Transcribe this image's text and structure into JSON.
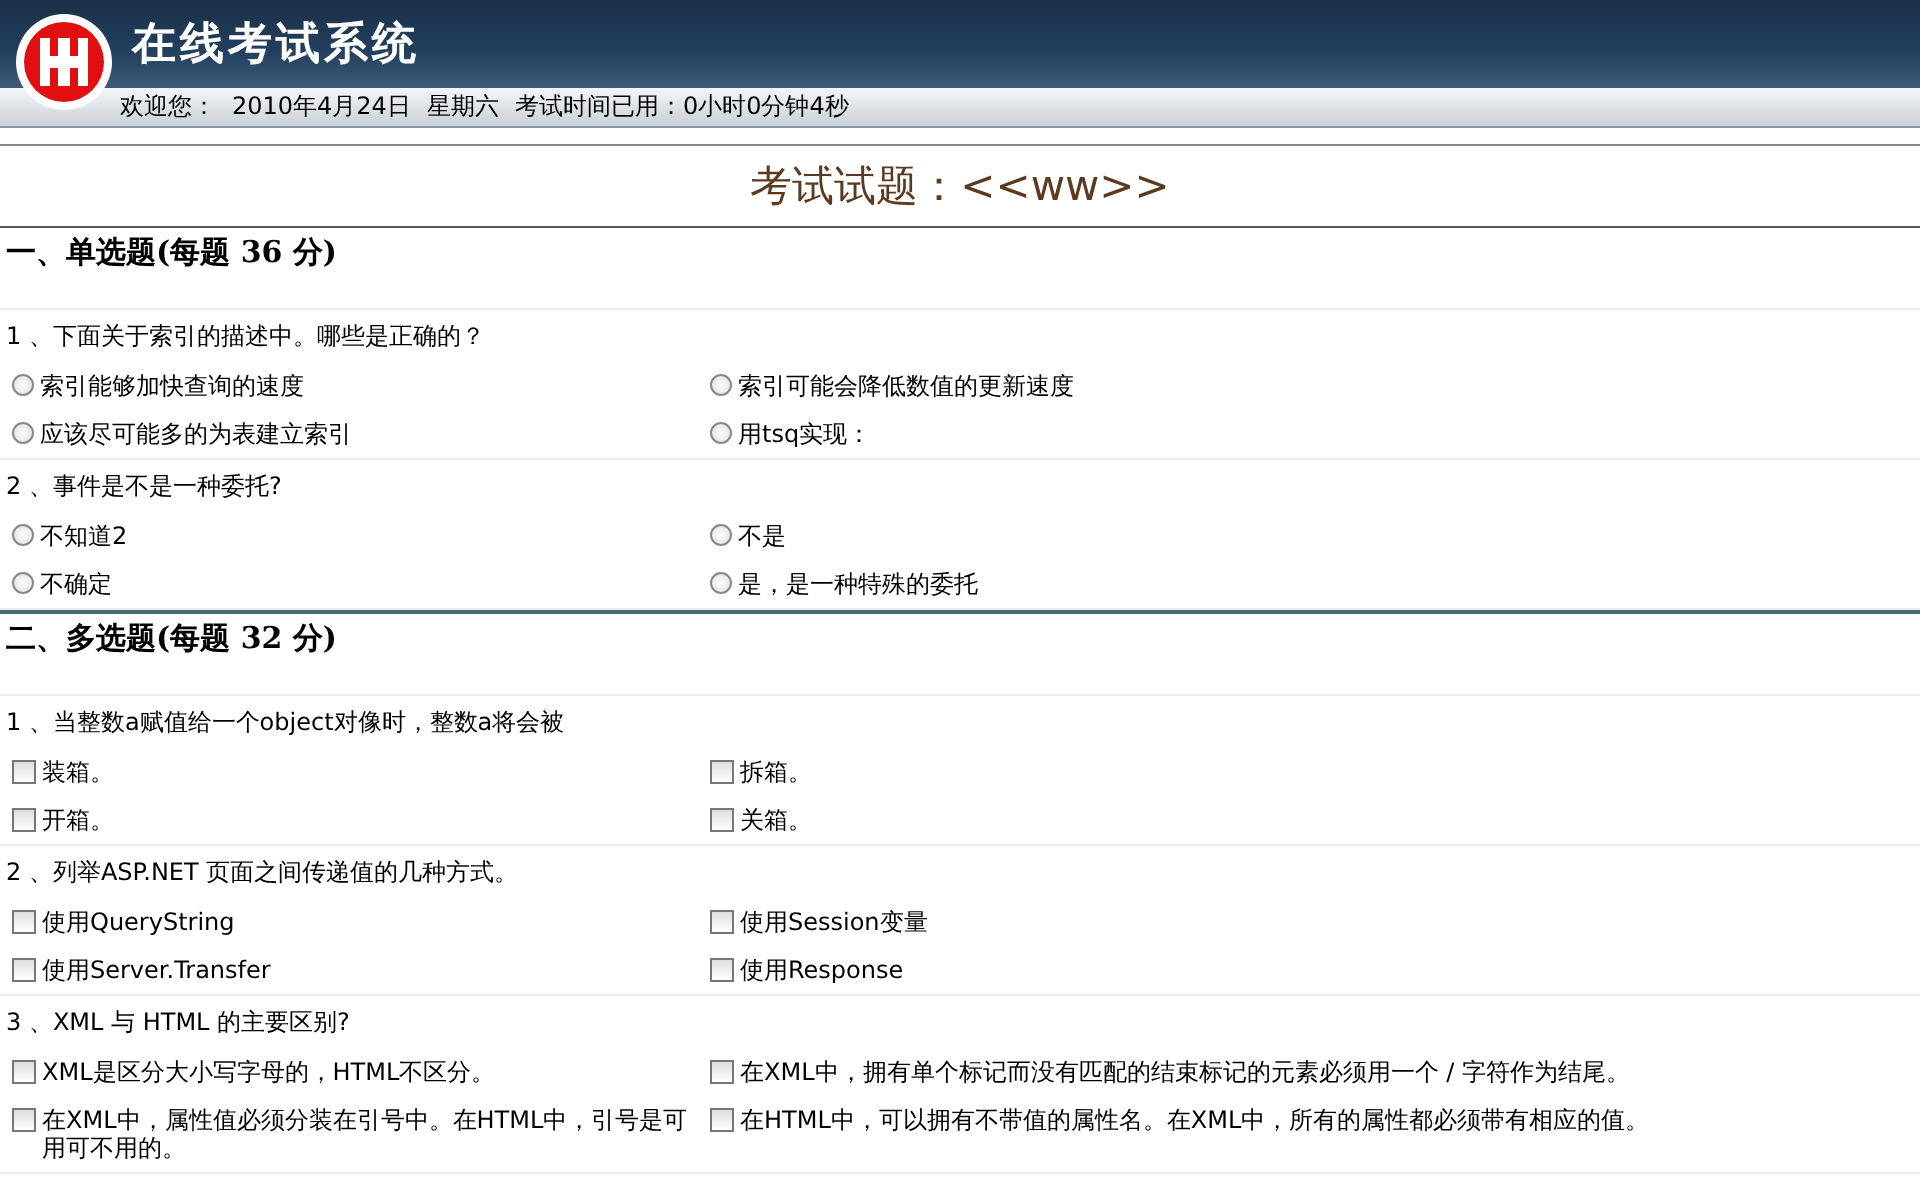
{
  "header": {
    "title": "在线考试系统",
    "status": [
      "欢迎您：",
      "2010年4月24日",
      "星期六",
      "考试时间已用：0小时0分钟4秒"
    ]
  },
  "exam_title": "考试试题：<<ww>>",
  "sections": [
    {
      "heading": "一、单选题(每题  36 分)",
      "kind": "radio",
      "questions": [
        {
          "prompt": "1 、下面关于索引的描述中。哪些是正确的？",
          "options": [
            {
              "label": "索引能够加快查询的速度",
              "selected": false
            },
            {
              "label": "索引可能会降低数值的更新速度",
              "selected": false
            },
            {
              "label": "应该尽可能多的为表建立索引",
              "selected": false
            },
            {
              "label": "用tsq实现：",
              "selected": false
            }
          ]
        },
        {
          "prompt": "2 、事件是不是一种委托?",
          "options": [
            {
              "label": "不知道2",
              "selected": false
            },
            {
              "label": "不是",
              "selected": false
            },
            {
              "label": "不确定",
              "selected": false
            },
            {
              "label": "是，是一种特殊的委托",
              "selected": false
            }
          ]
        }
      ]
    },
    {
      "heading": "二、多选题(每题  32 分)",
      "kind": "checkbox",
      "questions": [
        {
          "prompt": "1 、当整数a赋值给一个object对像时，整数a将会被",
          "options": [
            {
              "label": "装箱。",
              "checked": false
            },
            {
              "label": "拆箱。",
              "checked": false
            },
            {
              "label": "开箱。",
              "checked": false
            },
            {
              "label": "关箱。",
              "checked": false
            }
          ]
        },
        {
          "prompt": "2 、列举ASP.NET 页面之间传递值的几种方式。",
          "options": [
            {
              "label": "使用QueryString",
              "checked": false
            },
            {
              "label": "使用Session变量",
              "checked": false
            },
            {
              "label": "使用Server.Transfer",
              "checked": false
            },
            {
              "label": "使用Response",
              "checked": false
            }
          ]
        },
        {
          "prompt": "3 、XML 与  HTML 的主要区别?",
          "options": [
            {
              "label": "XML是区分大小写字母的，HTML不区分。",
              "checked": false
            },
            {
              "label": "在XML中，拥有单个标记而没有匹配的结束标记的元素必须用一个  / 字符作为结尾。",
              "checked": false
            },
            {
              "label": "在XML中，属性值必须分装在引号中。在HTML中，引号是可用可不用的。",
              "checked": false
            },
            {
              "label": "在HTML中，可以拥有不带值的属性名。在XML中，所有的属性都必须带有相应的值。",
              "checked": false
            }
          ]
        }
      ]
    }
  ]
}
